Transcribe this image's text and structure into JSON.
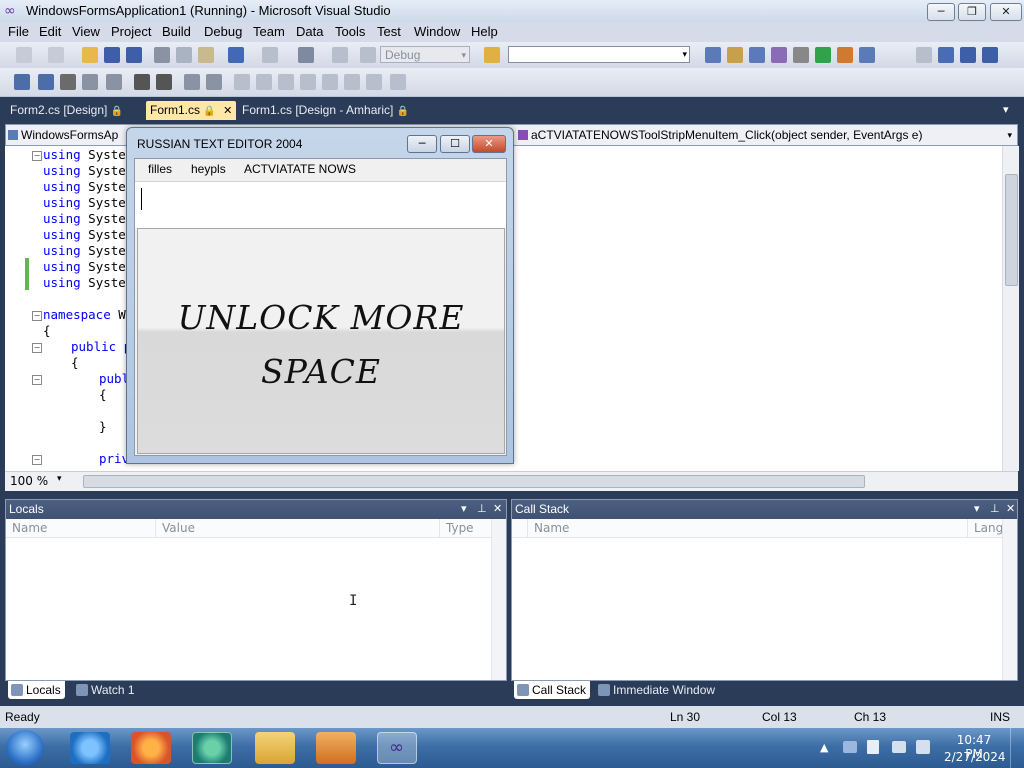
{
  "window": {
    "title": "WindowsFormsApplication1 (Running) - Microsoft Visual Studio",
    "minimize": "─",
    "restore": "❐",
    "close": "✕"
  },
  "menu": [
    "File",
    "Edit",
    "View",
    "Project",
    "Build",
    "Debug",
    "Team",
    "Data",
    "Tools",
    "Test",
    "Window",
    "Help"
  ],
  "toolbar": {
    "configuration": "Debug",
    "config_arrow": "▾",
    "find_value": "",
    "find_arrow": "▾"
  },
  "doc_tabs": [
    {
      "label": "Form2.cs [Design]",
      "lock": "🔒"
    },
    {
      "label": "Form1.cs",
      "lock": "🔒",
      "close": "✕"
    },
    {
      "label": "Form1.cs [Design - Amharic]",
      "lock": "🔒"
    }
  ],
  "tabs_overflow": "▾",
  "nav": {
    "left_combo": "WindowsFormsAp",
    "right_combo": "aCTVIATATENOWSToolStripMenuItem_Click(object sender, EventArgs e)",
    "arrow": "▾"
  },
  "code": {
    "using_kw": "using",
    "using_ns": "System",
    "namespace_kw": "namespace",
    "namespace_name": "Wi",
    "brace_open": "{",
    "brace_close": "}",
    "public_kw": "public",
    "p": "p",
    "publ": "publ",
    "private_kw": "private",
    "fold_minus": "−"
  },
  "zoom": "100 %",
  "zoom_arrow": "▾",
  "russian_editor": {
    "title": "RUSSIAN TEXT EDITOR 2004",
    "menu": [
      "filles",
      "heypls",
      "ACTVIATATE NOWS"
    ],
    "text_value": "",
    "banner_line1": "UNLOCK MORE",
    "banner_line2": "SPACE",
    "minimize": "─",
    "maximize": "☐",
    "close": "✕"
  },
  "locals": {
    "title": "Locals",
    "columns": [
      "Name",
      "Value",
      "Type"
    ],
    "controls": {
      "dropdown": "▾",
      "pin": "⊥",
      "close": "✕"
    }
  },
  "callstack": {
    "title": "Call Stack",
    "columns": [
      "Name",
      "Lang"
    ],
    "controls": {
      "dropdown": "▾",
      "pin": "⊥",
      "close": "✕"
    }
  },
  "bottom_tabs_left": [
    "Locals",
    "Watch 1"
  ],
  "bottom_tabs_right": [
    "Call Stack",
    "Immediate Window"
  ],
  "status": {
    "ready": "Ready",
    "ln": "Ln 30",
    "col": "Col 13",
    "ch": "Ch 13",
    "ins": "INS"
  },
  "taskbar": {
    "time": "10:47 PM",
    "date": "2/27/2024",
    "tray_arrow": "▲"
  },
  "colors": {
    "keyword": "#0000ff",
    "active_tab": "#ffe8a6",
    "pane_header": "#4d6082"
  }
}
